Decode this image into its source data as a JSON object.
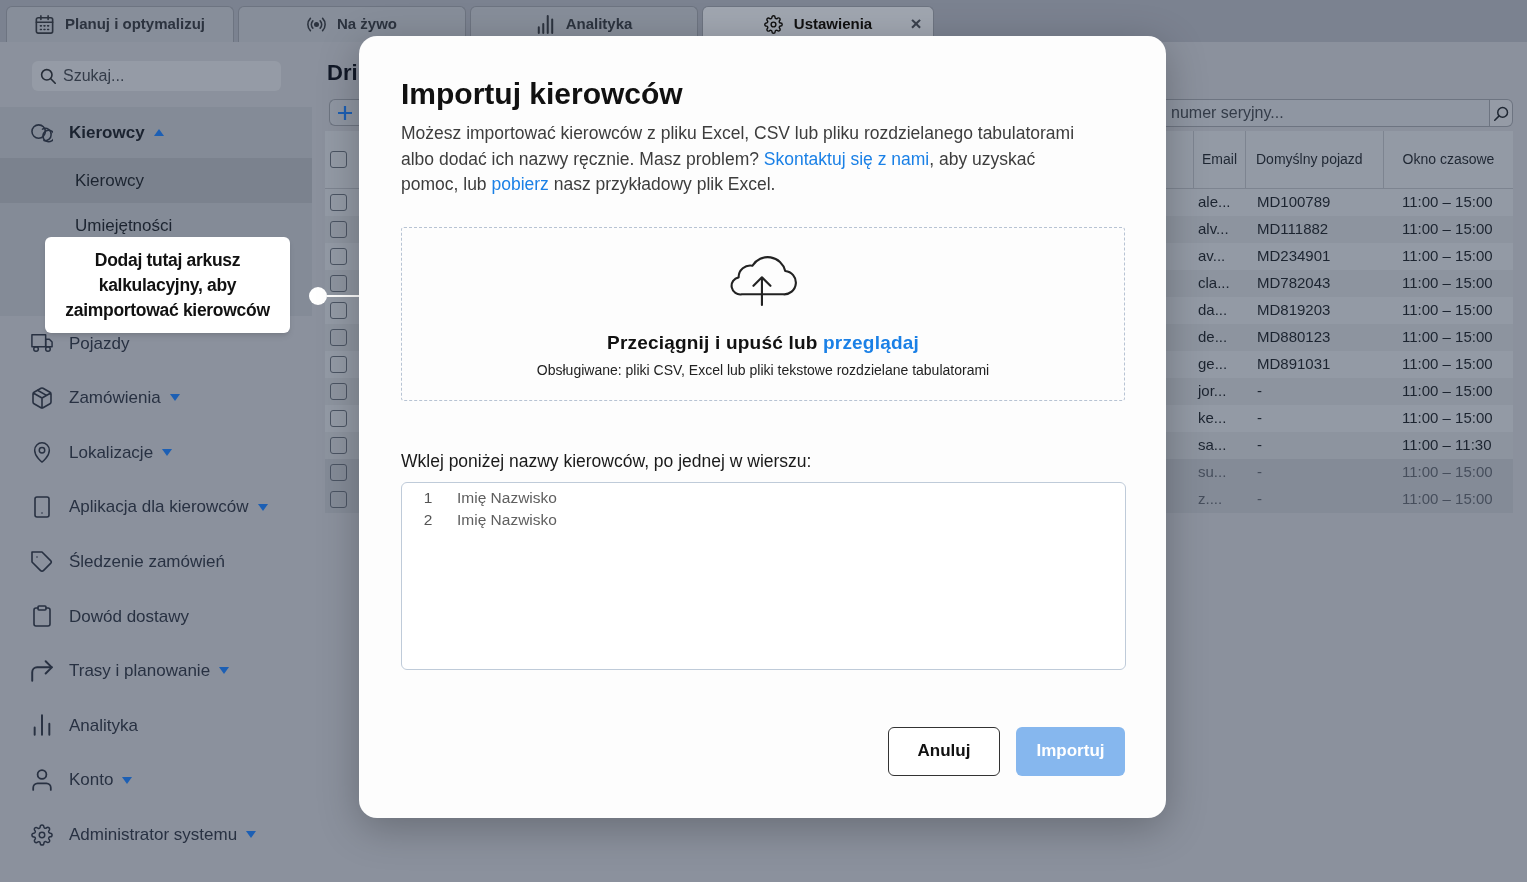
{
  "tabs": [
    {
      "label": "Planuj i optymalizuj",
      "selected": false
    },
    {
      "label": "Na żywo",
      "selected": false
    },
    {
      "label": "Analityka",
      "selected": false
    },
    {
      "label": "Ustawienia",
      "selected": true,
      "close": "×"
    }
  ],
  "sidebar": {
    "search": {
      "placeholder": "Szukaj..."
    },
    "items": [
      {
        "label": "Kierowcy",
        "kind": "group",
        "expanded": true,
        "children": [
          {
            "label": "Kierowcy",
            "selected": true
          },
          {
            "label": "Umiejętności",
            "selected": false
          }
        ]
      },
      {
        "label": "Pojazdy",
        "kind": "link"
      },
      {
        "label": "Zamówienia",
        "kind": "group",
        "expanded": false
      },
      {
        "label": "Lokalizacje",
        "kind": "group",
        "expanded": false
      },
      {
        "label": "Aplikacja dla kierowców",
        "kind": "group",
        "expanded": false
      },
      {
        "label": "Śledzenie zamówień",
        "kind": "link"
      },
      {
        "label": "Dowód dostawy",
        "kind": "link"
      },
      {
        "label": "Trasy i planowanie",
        "kind": "group",
        "expanded": false
      },
      {
        "label": "Analityka",
        "kind": "link"
      },
      {
        "label": "Konto",
        "kind": "group",
        "expanded": false
      },
      {
        "label": "Administrator systemu",
        "kind": "group",
        "expanded": false
      }
    ]
  },
  "callout": {
    "text": "Dodaj tutaj arkusz kalkulacyjny, aby zaimportować kierowców"
  },
  "main": {
    "title": "Dri",
    "search": {
      "placeholder": "numer seryjny..."
    },
    "table": {
      "all_checked": false,
      "columns": [
        "Email",
        "Domyślny pojazd",
        "Okno czasowe"
      ],
      "rows": [
        {
          "email": "ale...",
          "vehicle": "MD100789",
          "time_window": "11:00 – 15:00",
          "checked": false,
          "disabled": false
        },
        {
          "email": "alv...",
          "vehicle": "MD111882",
          "time_window": "11:00 – 15:00",
          "checked": false,
          "disabled": false
        },
        {
          "email": "av...",
          "vehicle": "MD234901",
          "time_window": "11:00 – 15:00",
          "checked": false,
          "disabled": false
        },
        {
          "email": "cla...",
          "vehicle": "MD782043",
          "time_window": "11:00 – 15:00",
          "checked": false,
          "disabled": false
        },
        {
          "email": "da...",
          "vehicle": "MD819203",
          "time_window": "11:00 – 15:00",
          "checked": false,
          "disabled": false
        },
        {
          "email": "de...",
          "vehicle": "MD880123",
          "time_window": "11:00 – 15:00",
          "checked": false,
          "disabled": false
        },
        {
          "email": "ge...",
          "vehicle": "MD891031",
          "time_window": "11:00 – 15:00",
          "checked": false,
          "disabled": false
        },
        {
          "email": "jor...",
          "vehicle": "-",
          "time_window": "11:00 – 15:00",
          "checked": false,
          "disabled": false
        },
        {
          "email": "ke...",
          "vehicle": "-",
          "time_window": "11:00 – 15:00",
          "checked": false,
          "disabled": false
        },
        {
          "email": "sa...",
          "vehicle": "-",
          "time_window": "11:00 – 11:30",
          "checked": false,
          "disabled": false
        },
        {
          "email": "su...",
          "vehicle": "-",
          "time_window": "11:00 – 15:00",
          "checked": false,
          "disabled": true
        },
        {
          "email": "z....",
          "vehicle": "-",
          "time_window": "11:00 – 15:00",
          "checked": false,
          "disabled": true
        }
      ]
    }
  },
  "dialog": {
    "title": "Importuj kierowców",
    "description": [
      {
        "kind": "text",
        "text": "Możesz importować kierowców z pliku Excel, CSV lub pliku rozdzielanego tabulatorami albo dodać ich nazwy ręcznie. Masz problem? "
      },
      {
        "kind": "link",
        "text": "Skontaktuj się z nami"
      },
      {
        "kind": "text",
        "text": ", aby uzyskać pomoc, lub "
      },
      {
        "kind": "link",
        "text": "pobierz"
      },
      {
        "kind": "text",
        "text": " nasz przykładowy plik Excel."
      }
    ],
    "dropzone": {
      "text": "Przeciągnij i upuść lub ",
      "link": "przeglądaj",
      "hint": "Obsługiwane: pliki CSV, Excel lub pliki tekstowe rozdzielane tabulatorami"
    },
    "paste": {
      "label": "Wklej poniżej nazwy kierowców, po jednej w wierszu:",
      "lines": [
        {
          "number": "1",
          "placeholder": "Imię Nazwisko"
        },
        {
          "number": "2",
          "placeholder": "Imię Nazwisko"
        }
      ]
    },
    "buttons": [
      {
        "label": "Anuluj",
        "kind": "secondary",
        "disabled": false
      },
      {
        "label": "Importuj",
        "kind": "primary",
        "disabled": true
      }
    ]
  }
}
